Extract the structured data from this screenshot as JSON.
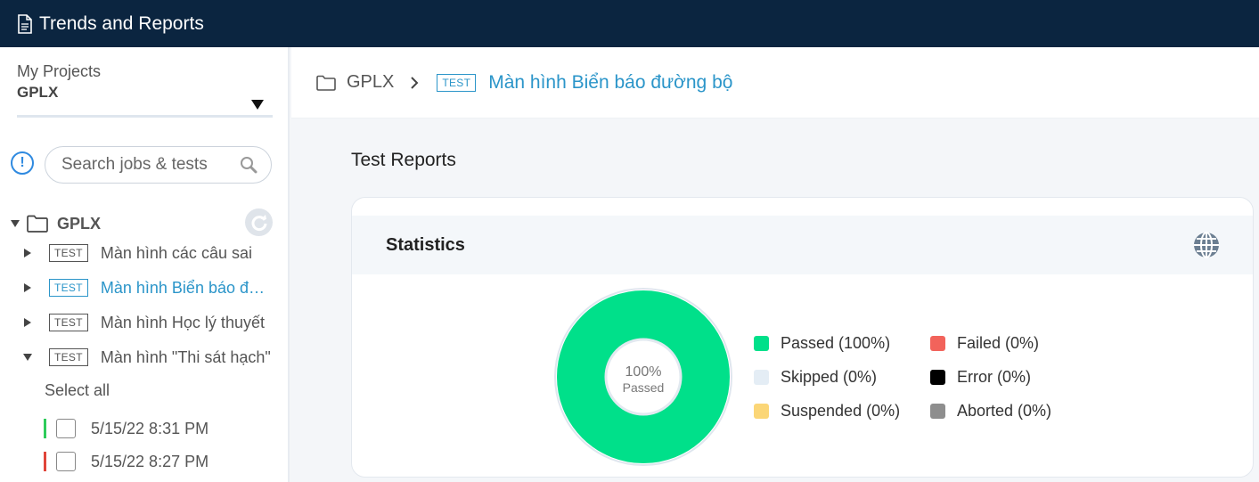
{
  "app": {
    "title": "Trends and Reports"
  },
  "sidebar": {
    "project_label": "My Projects",
    "project_value": "GPLX",
    "search_placeholder": "Search jobs & tests",
    "tree_root": "GPLX",
    "tag": "TEST",
    "items": [
      {
        "label": "Màn hình các câu sai",
        "expanded": false,
        "active": false
      },
      {
        "label": "Màn hình Biển báo đường bộ",
        "expanded": false,
        "active": true
      },
      {
        "label": "Màn hình Học lý thuyết",
        "expanded": false,
        "active": false
      },
      {
        "label": "Màn hình \"Thi sát hạch\"",
        "expanded": true,
        "active": false
      }
    ],
    "select_all": "Select all",
    "runs": [
      {
        "date": "5/15/22 8:31 PM",
        "status_color": "#2ecc5a"
      },
      {
        "date": "5/15/22 8:27 PM",
        "status_color": "#e0453a"
      }
    ]
  },
  "breadcrumb": {
    "root": "GPLX",
    "tag": "TEST",
    "current": "Màn hình Biển báo đường bộ"
  },
  "reports": {
    "section_title": "Test Reports",
    "card_title": "Statistics",
    "donut_value": "100%",
    "donut_label": "Passed",
    "legend": [
      {
        "label": "Passed (100%)",
        "color": "#00e08a"
      },
      {
        "label": "Failed (0%)",
        "color": "#f2635b"
      },
      {
        "label": "Skipped (0%)",
        "color": "#e4edf5"
      },
      {
        "label": "Error (0%)",
        "color": "#000000"
      },
      {
        "label": "Suspended (0%)",
        "color": "#fbd677"
      },
      {
        "label": "Aborted (0%)",
        "color": "#8e8e8e"
      }
    ]
  }
}
